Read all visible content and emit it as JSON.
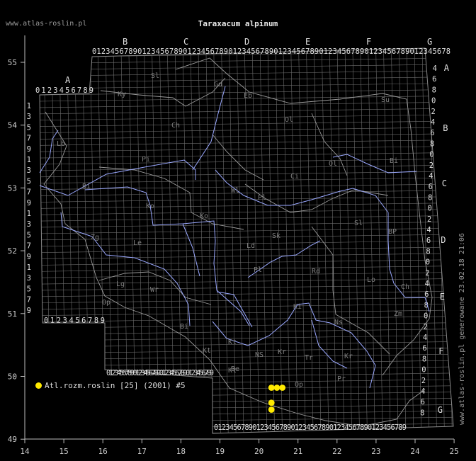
{
  "header": {
    "site_url": "www.atlas-roslin.pl",
    "title": "Taraxacum alpinum"
  },
  "side_stamp": "www.atlas-roslin.pl generowane 23.02.18 21:06",
  "legend": {
    "label": "Atl.rozm.roslin [25] (2001) #5",
    "dot_color": "#ffea00"
  },
  "axes": {
    "lon_ticks": [
      "14",
      "15",
      "16",
      "17",
      "18",
      "19",
      "20",
      "21",
      "22",
      "23",
      "24",
      "25"
    ],
    "lat_ticks": [
      "55",
      "54",
      "53",
      "52",
      "51",
      "50",
      "49"
    ]
  },
  "grid_labels": {
    "top_letters": [
      "B",
      "C",
      "D",
      "E",
      "F",
      "G"
    ],
    "left_letter": "A",
    "right_letters": [
      "A",
      "B",
      "C",
      "D",
      "E",
      "F",
      "G"
    ],
    "top_digits": "0123456789012345678901234567890123456789012345678901234567890123456789012345678",
    "a_row_digits": "0123456789",
    "bottom_row1_digits": "0123456789012345678901234567890123456789",
    "bottom_row2_digits": "01234567890123456789012345678901234567890123456789",
    "left_col_digits": [
      "1",
      "3",
      "5",
      "7",
      "9",
      "1",
      "3",
      "5",
      "7",
      "9",
      "1",
      "3",
      "5",
      "7",
      "9",
      "1",
      "3",
      "5",
      "7",
      "9"
    ],
    "right_col_digits": [
      "4",
      "6",
      "8",
      "0",
      "2",
      "4",
      "6",
      "8",
      "0",
      "2",
      "4",
      "6",
      "8",
      "0",
      "2",
      "4",
      "6",
      "8",
      "0",
      "2",
      "4",
      "6",
      "8",
      "0",
      "2",
      "4",
      "6",
      "8",
      "0",
      "2",
      "4",
      "6",
      "8"
    ]
  },
  "region_codes": [
    "Sl",
    "Ky",
    "Gd",
    "Eb",
    "Ch",
    "Ol",
    "Su",
    "Bi",
    "Pi",
    "Ci",
    "Ol",
    "Wl",
    "Pl",
    "Bi",
    "Ko",
    "Sk",
    "Ko",
    "Ld",
    "Sl",
    "BP",
    "Zg",
    "Le",
    "Lo",
    "Pl",
    "Rd",
    "Lb",
    "Ch",
    "Wr",
    "Lg",
    "Op",
    "Ki",
    "Zm",
    "Kt",
    "Tr",
    "Kr",
    "Ns",
    "Pr",
    "Op",
    "NS",
    "Kr",
    "Kt",
    "Bi",
    "Kt",
    "Be"
  ],
  "occurrences": [
    {
      "lon": 20.32,
      "lat": 49.82
    },
    {
      "lon": 20.46,
      "lat": 49.82
    },
    {
      "lon": 20.6,
      "lat": 49.82
    },
    {
      "lon": 20.32,
      "lat": 49.58
    },
    {
      "lon": 20.32,
      "lat": 49.47
    }
  ]
}
